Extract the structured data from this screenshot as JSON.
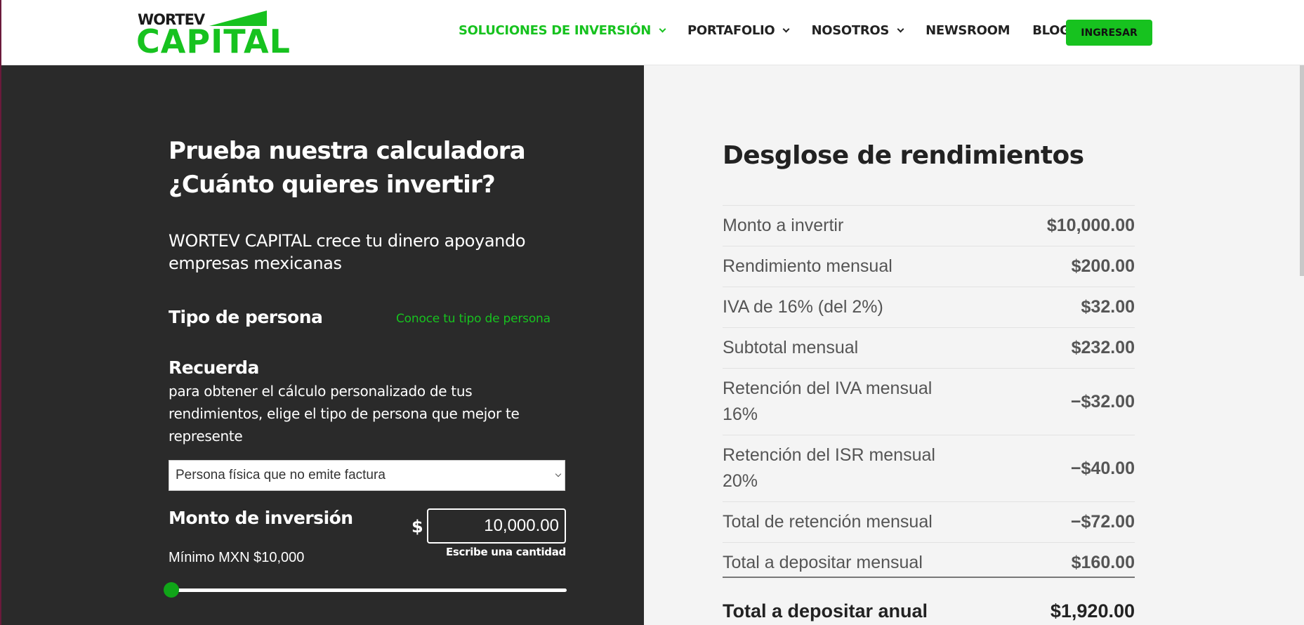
{
  "header": {
    "logo_small": "WORTEV",
    "logo_big": "CAPITAL",
    "nav": [
      {
        "label": "SOLUCIONES DE INVERSIÓN",
        "dropdown": true,
        "active": true
      },
      {
        "label": "PORTAFOLIO",
        "dropdown": true,
        "active": false
      },
      {
        "label": "NOSOTROS",
        "dropdown": true,
        "active": false
      },
      {
        "label": "NEWSROOM",
        "dropdown": false,
        "active": false
      },
      {
        "label": "BLOG",
        "dropdown": false,
        "active": false
      }
    ],
    "login_label": "INGRESAR"
  },
  "calculator": {
    "title_line1": "Prueba nuestra calculadora",
    "title_line2": "¿Cuánto quieres invertir?",
    "subtitle": "WORTEV CAPITAL crece tu dinero apoyando empresas mexicanas",
    "tipo_label": "Tipo de persona",
    "tipo_link": "Conoce tu tipo de persona",
    "recuerda_title": "Recuerda",
    "recuerda_text": "para obtener el cálculo personalizado de tus rendimientos, elige el tipo de persona que mejor te represente",
    "tipo_selected": "Persona física que no emite factura",
    "monto_label": "Monto de inversión",
    "currency_symbol": "$",
    "monto_value": "10,000.00",
    "monto_hint": "Escribe una cantidad",
    "minimo": "Mínimo MXN $10,000",
    "slider_fraction": 0.0
  },
  "breakdown": {
    "title": "Desglose de rendimientos",
    "rows": [
      {
        "label": "Monto a invertir",
        "value": "$10,000.00"
      },
      {
        "label": "Rendimiento mensual",
        "value": "$200.00"
      },
      {
        "label": "IVA de 16% (del 2%)",
        "value": "$32.00"
      },
      {
        "label": "Subtotal mensual",
        "value": "$232.00"
      },
      {
        "label": "Retención del IVA mensual 16%",
        "value": "−$32.00"
      },
      {
        "label": "Retención del ISR mensual 20%",
        "value": "−$40.00"
      },
      {
        "label": "Total de retención mensual",
        "value": "−$72.00"
      },
      {
        "label": "Total a depositar mensual",
        "value": "$160.00"
      }
    ],
    "total_label": "Total a depositar anual",
    "total_value": "$1,920.00"
  },
  "colors": {
    "brand_green": "#17c21f",
    "dark_panel": "#2a2a2a",
    "light_panel": "#f4f4f4"
  }
}
